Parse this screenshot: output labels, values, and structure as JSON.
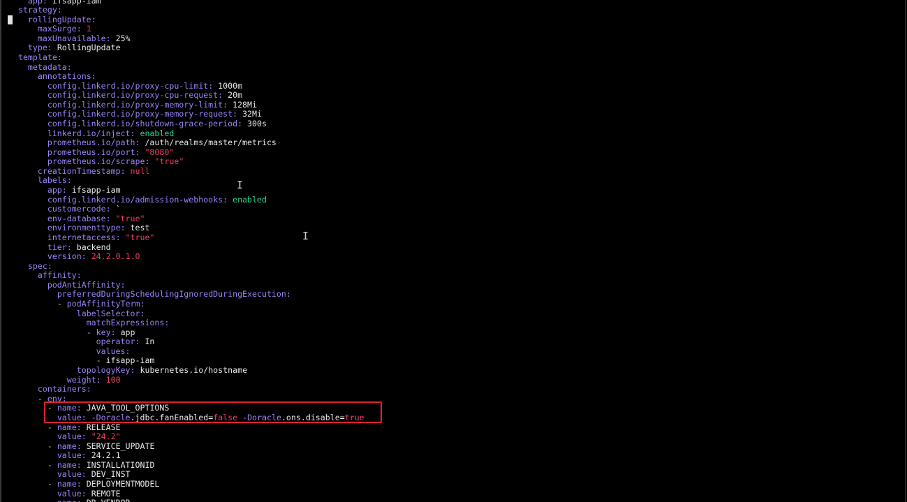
{
  "colors": {
    "background": "#000000",
    "key": "#9d83f7",
    "string": "#ef3d60",
    "boolean_true": "#2fd48a",
    "plain": "#e8e8e8",
    "highlight_box": "#e0222a"
  },
  "cursor_icon": "text-ibeam-icon",
  "lines": [
    {
      "indent": "    ",
      "dash": "",
      "key": "app",
      "sep": ": ",
      "value": "ifsapp-iam",
      "vtype": "v"
    },
    {
      "indent": "  ",
      "dash": "",
      "key": "strategy",
      "sep": ":",
      "value": "",
      "vtype": "v"
    },
    {
      "indent": "    ",
      "dash": "",
      "key": "rollingUpdate",
      "sep": ":",
      "value": "",
      "vtype": "v"
    },
    {
      "indent": "      ",
      "dash": "",
      "key": "maxSurge",
      "sep": ": ",
      "value": "1",
      "vtype": "n"
    },
    {
      "indent": "      ",
      "dash": "",
      "key": "maxUnavailable",
      "sep": ": ",
      "value": "25%",
      "vtype": "v"
    },
    {
      "indent": "    ",
      "dash": "",
      "key": "type",
      "sep": ": ",
      "value": "RollingUpdate",
      "vtype": "v"
    },
    {
      "indent": "  ",
      "dash": "",
      "key": "template",
      "sep": ":",
      "value": "",
      "vtype": "v"
    },
    {
      "indent": "    ",
      "dash": "",
      "key": "metadata",
      "sep": ":",
      "value": "",
      "vtype": "v"
    },
    {
      "indent": "      ",
      "dash": "",
      "key": "annotations",
      "sep": ":",
      "value": "",
      "vtype": "v"
    },
    {
      "indent": "        ",
      "dash": "",
      "key": "config.linkerd.io/proxy-cpu-limit",
      "sep": ": ",
      "value": "1000m",
      "vtype": "v"
    },
    {
      "indent": "        ",
      "dash": "",
      "key": "config.linkerd.io/proxy-cpu-request",
      "sep": ": ",
      "value": "20m",
      "vtype": "v"
    },
    {
      "indent": "        ",
      "dash": "",
      "key": "config.linkerd.io/proxy-memory-limit",
      "sep": ": ",
      "value": "128Mi",
      "vtype": "v"
    },
    {
      "indent": "        ",
      "dash": "",
      "key": "config.linkerd.io/proxy-memory-request",
      "sep": ": ",
      "value": "32Mi",
      "vtype": "v"
    },
    {
      "indent": "        ",
      "dash": "",
      "key": "config.linkerd.io/shutdown-grace-period",
      "sep": ": ",
      "value": "300s",
      "vtype": "v"
    },
    {
      "indent": "        ",
      "dash": "",
      "key": "linkerd.io/inject",
      "sep": ": ",
      "value": "enabled",
      "vtype": "g"
    },
    {
      "indent": "        ",
      "dash": "",
      "key": "prometheus.io/path",
      "sep": ": ",
      "value": "/auth/realms/master/metrics",
      "vtype": "v"
    },
    {
      "indent": "        ",
      "dash": "",
      "key": "prometheus.io/port",
      "sep": ": ",
      "value": "\"8080\"",
      "vtype": "s"
    },
    {
      "indent": "        ",
      "dash": "",
      "key": "prometheus.io/scrape",
      "sep": ": ",
      "value": "\"true\"",
      "vtype": "s"
    },
    {
      "indent": "      ",
      "dash": "",
      "key": "creationTimestamp",
      "sep": ": ",
      "value": "null",
      "vtype": "n"
    },
    {
      "indent": "      ",
      "dash": "",
      "key": "labels",
      "sep": ":",
      "value": "",
      "vtype": "v"
    },
    {
      "indent": "        ",
      "dash": "",
      "key": "app",
      "sep": ": ",
      "value": "ifsapp-iam",
      "vtype": "v"
    },
    {
      "indent": "        ",
      "dash": "",
      "key": "config.linkerd.io/admission-webhooks",
      "sep": ": ",
      "value": "enabled",
      "vtype": "g"
    },
    {
      "indent": "        ",
      "dash": "",
      "key": "customercode",
      "sep": ": ",
      "value": "`",
      "vtype": "v"
    },
    {
      "indent": "        ",
      "dash": "",
      "key": "env-database",
      "sep": ": ",
      "value": "\"true\"",
      "vtype": "s"
    },
    {
      "indent": "        ",
      "dash": "",
      "key": "environmenttype",
      "sep": ": ",
      "value": "test",
      "vtype": "v"
    },
    {
      "indent": "        ",
      "dash": "",
      "key": "internetaccess",
      "sep": ": ",
      "value": "\"true\"",
      "vtype": "s"
    },
    {
      "indent": "        ",
      "dash": "",
      "key": "tier",
      "sep": ": ",
      "value": "backend",
      "vtype": "v"
    },
    {
      "indent": "        ",
      "dash": "",
      "key": "version",
      "sep": ": ",
      "value": "24.2.0.1.0",
      "vtype": "n"
    },
    {
      "indent": "    ",
      "dash": "",
      "key": "spec",
      "sep": ":",
      "value": "",
      "vtype": "v"
    },
    {
      "indent": "      ",
      "dash": "",
      "key": "affinity",
      "sep": ":",
      "value": "",
      "vtype": "v"
    },
    {
      "indent": "        ",
      "dash": "",
      "key": "podAntiAffinity",
      "sep": ":",
      "value": "",
      "vtype": "v"
    },
    {
      "indent": "          ",
      "dash": "",
      "key": "preferredDuringSchedulingIgnoredDuringExecution",
      "sep": ":",
      "value": "",
      "vtype": "v"
    },
    {
      "indent": "          ",
      "dash": "- ",
      "key": "podAffinityTerm",
      "sep": ":",
      "value": "",
      "vtype": "v"
    },
    {
      "indent": "              ",
      "dash": "",
      "key": "labelSelector",
      "sep": ":",
      "value": "",
      "vtype": "v"
    },
    {
      "indent": "                ",
      "dash": "",
      "key": "matchExpressions",
      "sep": ":",
      "value": "",
      "vtype": "v"
    },
    {
      "indent": "                ",
      "dash": "- ",
      "key": "key",
      "sep": ": ",
      "value": "app",
      "vtype": "v"
    },
    {
      "indent": "                  ",
      "dash": "",
      "key": "operator",
      "sep": ": ",
      "value": "In",
      "vtype": "v"
    },
    {
      "indent": "                  ",
      "dash": "",
      "key": "values",
      "sep": ":",
      "value": "",
      "vtype": "v"
    },
    {
      "indent": "                  ",
      "dash": "- ",
      "key": "",
      "sep": "",
      "value": "ifsapp-iam",
      "vtype": "v"
    },
    {
      "indent": "              ",
      "dash": "",
      "key": "topologyKey",
      "sep": ": ",
      "value": "kubernetes.io/hostname",
      "vtype": "v"
    },
    {
      "indent": "            ",
      "dash": "",
      "key": "weight",
      "sep": ": ",
      "value": "100",
      "vtype": "n"
    },
    {
      "indent": "      ",
      "dash": "",
      "key": "containers",
      "sep": ":",
      "value": "",
      "vtype": "v"
    },
    {
      "indent": "      ",
      "dash": "- ",
      "key": "env",
      "sep": ":",
      "value": "",
      "vtype": "v"
    },
    {
      "indent": "        ",
      "dash": "- ",
      "key": "name",
      "sep": ": ",
      "value": "JAVA_TOOL_OPTIONS",
      "vtype": "v"
    },
    {
      "indent": "          ",
      "dash": "",
      "key": "value",
      "sep": ": ",
      "value": "",
      "vtype": "v",
      "rich": [
        {
          "t": "-Doracle",
          "c": "k"
        },
        {
          "t": ".jdbc.fanEnabled=",
          "c": "v"
        },
        {
          "t": "false",
          "c": "s"
        },
        {
          "t": " -Doracle",
          "c": "k"
        },
        {
          "t": ".ons.disable=",
          "c": "v"
        },
        {
          "t": "true",
          "c": "s"
        }
      ]
    },
    {
      "indent": "        ",
      "dash": "- ",
      "key": "name",
      "sep": ": ",
      "value": "RELEASE",
      "vtype": "v"
    },
    {
      "indent": "          ",
      "dash": "",
      "key": "value",
      "sep": ": ",
      "value": "\"24.2\"",
      "vtype": "s"
    },
    {
      "indent": "        ",
      "dash": "- ",
      "key": "name",
      "sep": ": ",
      "value": "SERVICE_UPDATE",
      "vtype": "v"
    },
    {
      "indent": "          ",
      "dash": "",
      "key": "value",
      "sep": ": ",
      "value": "24.2.1",
      "vtype": "v"
    },
    {
      "indent": "        ",
      "dash": "- ",
      "key": "name",
      "sep": ": ",
      "value": "INSTALLATIONID",
      "vtype": "v"
    },
    {
      "indent": "          ",
      "dash": "",
      "key": "value",
      "sep": ": ",
      "value": "DEV_INST",
      "vtype": "v"
    },
    {
      "indent": "        ",
      "dash": "- ",
      "key": "name",
      "sep": ": ",
      "value": "DEPLOYMENTMODEL",
      "vtype": "v"
    },
    {
      "indent": "          ",
      "dash": "",
      "key": "value",
      "sep": ": ",
      "value": "REMOTE",
      "vtype": "v"
    },
    {
      "indent": "        ",
      "dash": "- ",
      "key": "name",
      "sep": ": ",
      "value": "DB_VENDOR",
      "vtype": "v"
    }
  ]
}
